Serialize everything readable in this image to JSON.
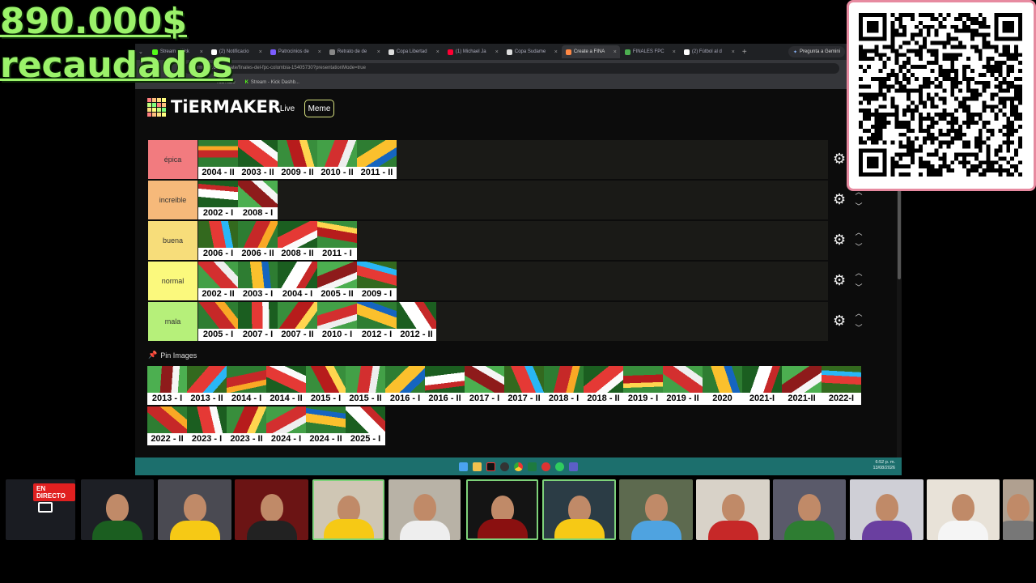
{
  "overlay": {
    "amount": "890.000$",
    "caption": "recaudados"
  },
  "browser": {
    "tabs": [
      {
        "label": "Stream - Kick",
        "color": "#53fc18"
      },
      {
        "label": "(2) Notificacio",
        "color": "#ffffff"
      },
      {
        "label": "Patrocinios de",
        "color": "#7b5cff"
      },
      {
        "label": "Retrato de de",
        "color": "#888888"
      },
      {
        "label": "Copa Libertad",
        "color": "#dddddd"
      },
      {
        "label": "(1) Michael Ja",
        "color": "#ff0033"
      },
      {
        "label": "Copa Sudame",
        "color": "#dddddd"
      },
      {
        "label": "Create a FINA",
        "color": "#ff8844"
      },
      {
        "label": "FINALES FPC",
        "color": "#4caf50"
      },
      {
        "label": "(2) Fútbol al d",
        "color": "#ffffff"
      }
    ],
    "gemini_label": "Pregunta a Gemini",
    "url": "tiermaker.com/create/finales-del-fpc-colombia-15405730?presentationMode=true",
    "bookmarks": [
      "YouTube",
      "Stream - Kick Dashb..."
    ]
  },
  "tiermaker": {
    "logo_text": "TiERMAKER",
    "live_label": "Live",
    "meme_label": "Meme",
    "tiers": [
      {
        "name": "épica",
        "color": "#f27b7f",
        "items": [
          "2004 - II",
          "2003 - II",
          "2009 - II",
          "2010 - II",
          "2011 - II"
        ]
      },
      {
        "name": "increible",
        "color": "#f6b97a",
        "items": [
          "2002 - I",
          "2008 - I"
        ]
      },
      {
        "name": "buena",
        "color": "#f7dd7a",
        "items": [
          "2006 - I",
          "2006 - II",
          "2008 - II",
          "2011 - I"
        ]
      },
      {
        "name": "normal",
        "color": "#fbf97d",
        "items": [
          "2002 - II",
          "2003 - I",
          "2004 - I",
          "2005 - II",
          "2009 - I"
        ]
      },
      {
        "name": "mala",
        "color": "#b6f07a",
        "items": [
          "2005 - I",
          "2007 - I",
          "2007 - II",
          "2010 - I",
          "2012 - I",
          "2012 - II"
        ]
      }
    ],
    "pin_images_label": "Pin Images",
    "pool_row1": [
      "2013 - I",
      "2013 - II",
      "2014 - I",
      "2014 - II",
      "2015 - I",
      "2015 - II",
      "2016 - I",
      "2016 - II",
      "2017 - I",
      "2017 - II",
      "2018 - I",
      "2018 - II",
      "2019 - I",
      "2019 - II",
      "2020",
      "2021-I",
      "2021-II",
      "2022-I"
    ],
    "pool_row2": [
      "2022 - II",
      "2023 - I",
      "2023 - II",
      "2024 - I",
      "2024 - II",
      "2025 - I"
    ]
  },
  "taskbar": {
    "time": "6:52 p. m.",
    "date": "13/08/2026"
  },
  "stream": {
    "live_badge": "EN DIRECTO"
  }
}
